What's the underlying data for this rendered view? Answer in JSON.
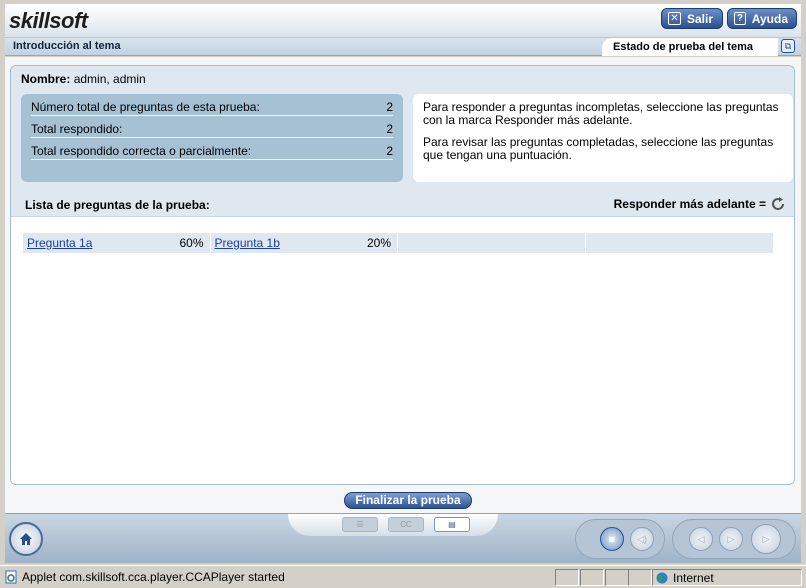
{
  "header": {
    "logo_text": "skillsoft",
    "exit_label": "Salir",
    "help_label": "Ayuda"
  },
  "titlebar": {
    "topic": "Introducción al tema",
    "status_tab": "Estado de prueba del tema"
  },
  "summary": {
    "name_label": "Nombre:",
    "name_value": "admin, admin",
    "stats": [
      {
        "label": "Número total de preguntas de esta prueba:",
        "value": "2"
      },
      {
        "label": "Total respondido:",
        "value": "2"
      },
      {
        "label": "Total respondido correcta o parcialmente:",
        "value": "2"
      }
    ],
    "info": [
      "Para responder a preguntas incompletas, seleccione las preguntas con la marca Responder más adelante.",
      "Para revisar las preguntas completadas, seleccione las preguntas que tengan una puntuación."
    ]
  },
  "question_list": {
    "title": "Lista de preguntas de la prueba:",
    "answer_later_label": "Responder más adelante =",
    "questions": [
      {
        "label": "Pregunta 1a",
        "score": "60%"
      },
      {
        "label": "Pregunta 1b",
        "score": "20%"
      }
    ]
  },
  "finish_label": "Finalizar la prueba",
  "statusbar": {
    "message": "Applet com.skillsoft.cca.player.CCAPlayer started",
    "zone": "Internet"
  },
  "colors": {
    "accent": "#2a4f8f",
    "panel_blue": "#a6c0d4",
    "link": "#1a3fa0"
  }
}
